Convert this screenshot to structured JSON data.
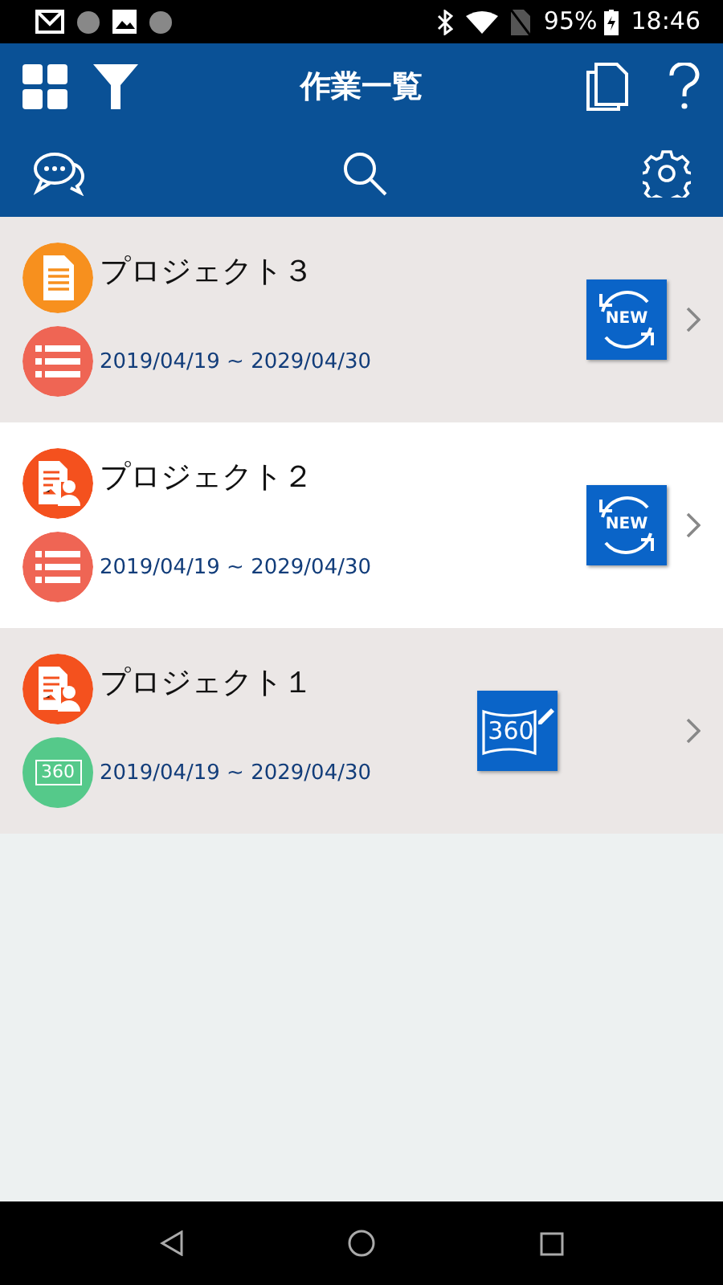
{
  "status_bar": {
    "battery": "95%",
    "time": "18:46"
  },
  "header": {
    "title": "作業一覧"
  },
  "projects": [
    {
      "title": "プロジェクト３",
      "date": "2019/04/19 ~ 2029/04/30",
      "shaded": true,
      "type_icon": {
        "kind": "document"
      },
      "sub_icon": {
        "kind": "list"
      },
      "action": {
        "kind": "new",
        "label": "NEW"
      }
    },
    {
      "title": "プロジェクト２",
      "date": "2019/04/19 ~ 2029/04/30",
      "shaded": false,
      "type_icon": {
        "kind": "assign"
      },
      "sub_icon": {
        "kind": "list"
      },
      "action": {
        "kind": "new",
        "label": "NEW"
      }
    },
    {
      "title": "プロジェクト１",
      "date": "2019/04/19 ~ 2029/04/30",
      "shaded": true,
      "type_icon": {
        "kind": "assign"
      },
      "sub_icon": {
        "kind": "panorama",
        "label": "360"
      },
      "action": {
        "kind": "panorama",
        "label": "360"
      }
    }
  ]
}
